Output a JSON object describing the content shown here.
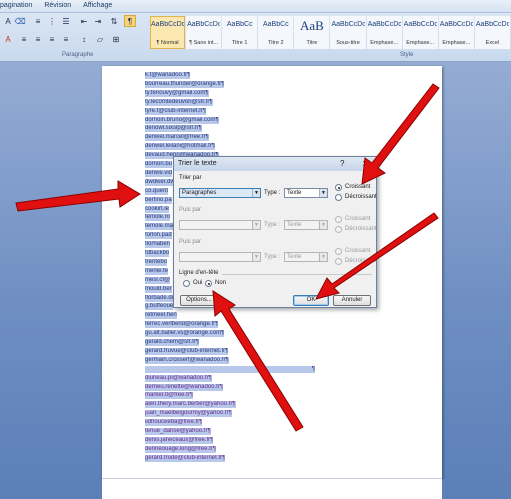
{
  "ribbon": {
    "tabs": [
      "pagination",
      "Révision",
      "Affichage"
    ],
    "group_paragraph": "Paragraphe",
    "group_style": "Style",
    "styles": [
      {
        "sample": "AaBbCcDc",
        "name": "¶ Normal",
        "active": true
      },
      {
        "sample": "AaBbCcDc",
        "name": "¶ Sans int...",
        "active": false
      },
      {
        "sample": "AaBbCc",
        "name": "Titre 1",
        "active": false
      },
      {
        "sample": "AaBbCc",
        "name": "Titre 2",
        "active": false
      },
      {
        "sample": "AaB",
        "name": "Titre",
        "big": true,
        "active": false
      },
      {
        "sample": "AaBbCcDc",
        "name": "Sous-titre",
        "active": false
      },
      {
        "sample": "AaBbCcDc",
        "name": "Emphase...",
        "active": false
      },
      {
        "sample": "AaBbCcDc",
        "name": "Emphase...",
        "active": false
      },
      {
        "sample": "AaBbCcDc",
        "name": "Emphase...",
        "active": false
      },
      {
        "sample": "AaBbCcDc",
        "name": "Excel",
        "active": false
      }
    ]
  },
  "document": {
    "lines": [
      {
        "text": "k.t@wanadoo.fr¶",
        "style": "sel"
      },
      {
        "text": "bourreau.thunder@orange.fr¶",
        "style": "sel"
      },
      {
        "text": "ty.fenouvy@gmail.com¶",
        "style": "sel"
      },
      {
        "text": "ty.lecomtedeuvon@sfr.fr¶",
        "style": "sel"
      },
      {
        "text": "tyre.f@club-internet.fr¶",
        "style": "sel"
      },
      {
        "text": "dornoin.bruno@gmail.com¶",
        "style": "sel"
      },
      {
        "text": "denowl.sixslp@sfr.fr¶",
        "style": "sel"
      },
      {
        "text": "denwel.marcel@free.fr¶",
        "style": "sel"
      },
      {
        "text": "denwel.leilani@hotmail.fr¶",
        "style": "sel"
      },
      {
        "text": "devaud.henri@wanadoo.fr¶",
        "style": "sel"
      },
      {
        "text": "dornon.bu",
        "style": "sel"
      },
      {
        "text": "denwe.vid",
        "style": "sel"
      },
      {
        "text": "dwdwer.dw",
        "style": "sel"
      },
      {
        "text": "co.quent",
        "style": "sel"
      },
      {
        "text": "bertino.pa",
        "style": "sel"
      },
      {
        "text": "cookirt.le",
        "style": "sel"
      },
      {
        "text": "temole.ro",
        "style": "sel"
      },
      {
        "text": "temole.mat",
        "style": "sel"
      },
      {
        "text": "forlon.pad",
        "style": "sel"
      },
      {
        "text": "florhaberi",
        "style": "sel"
      },
      {
        "text": "fdbackbo",
        "style": "sel"
      },
      {
        "text": "trentebo",
        "style": "sel"
      },
      {
        "text": "merlie.fe",
        "style": "sel"
      },
      {
        "text": "mesl.cf@",
        "style": "sel"
      },
      {
        "text": "fnould.ber",
        "style": "sel"
      },
      {
        "text": "florbade.di",
        "style": "sel"
      },
      {
        "text": "g.buffeoue",
        "style": "sel"
      },
      {
        "text": "retmeel.hen",
        "style": "sel"
      },
      {
        "text": "ferrec.verlbend@orange.fr¶",
        "style": "sel"
      },
      {
        "text": "gu.alt.baller.vs@orange.com¶",
        "style": "sel"
      },
      {
        "text": "gerald.chem@sfr.fr¶",
        "style": "sel"
      },
      {
        "text": "gerard.fruvue@club-internet.fr¶",
        "style": "sel"
      },
      {
        "text": "germain.crossert@wanadoo.fr¶",
        "style": "sel"
      },
      {
        "text": "¶",
        "style": "sel-wide"
      },
      {
        "text": "diuneau.pi@wanadoo.fr¶",
        "style": "sel purple"
      },
      {
        "text": "derneu.renette@wanadoo.fr¶",
        "style": "sel purple"
      },
      {
        "text": "marker.tl@free.fr¶",
        "style": "sel purple"
      },
      {
        "text": "alen.thery.marc.bertier@yahoo.fr¶",
        "style": "sel purple"
      },
      {
        "text": "juan_maelbelgourmy@yahoo.fr¶",
        "style": "sel purple"
      },
      {
        "text": "iidhouceeba@free.fr¶",
        "style": "sel purple"
      },
      {
        "text": "tenue_danse@yahoo.fr¶",
        "style": "sel purple"
      },
      {
        "text": "denis.janeceaux@free.fr¶",
        "style": "sel purple"
      },
      {
        "text": "denneouage.king@free.fr¶",
        "style": "sel purple"
      },
      {
        "text": "gerard.frode@club-internet.fr¶",
        "style": "sel purple"
      }
    ]
  },
  "dialog": {
    "title": "Trier le texte",
    "help": "?",
    "close": "x",
    "sort_by_label": "Trier par",
    "sort_by_value": "Paragraphes",
    "type_label": "Type :",
    "type_value": "Texte",
    "asc_label": "Croissant",
    "desc_label": "Décroissant",
    "then_by_label": "Puis par",
    "then_by_value": "",
    "then_type_value": "Texte",
    "then_asc_label": "Croissant",
    "then_desc_label": "Décroissant",
    "then_by2_label": "Puis par",
    "then_by2_value": "",
    "then_type2_value": "Texte",
    "then_asc2_label": "Croissant",
    "then_desc2_label": "Décroissant",
    "header_row_label": "Ligne d'en-tête",
    "yes_label": "Oui",
    "no_label": "Non",
    "options_button": "Options...",
    "ok_button": "OK",
    "cancel_button": "Annuler"
  },
  "colors": {
    "selection": "#b7c8ea",
    "arrow": "#e01010",
    "ribbon": "#c9d9ee"
  }
}
